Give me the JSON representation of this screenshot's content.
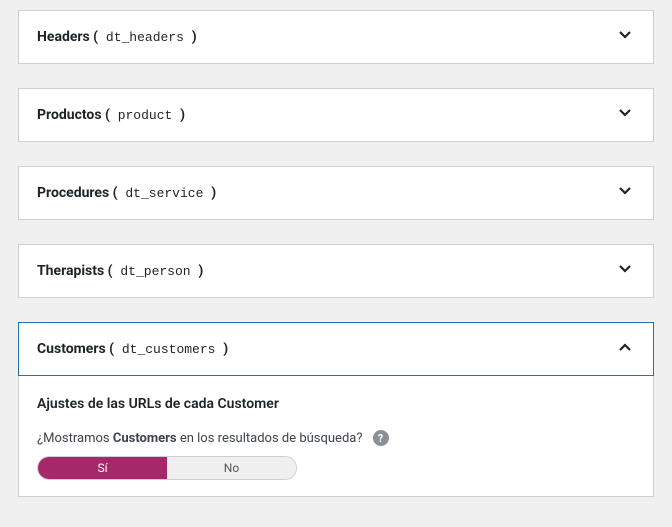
{
  "panels": [
    {
      "label": "Headers",
      "slug": "dt_headers",
      "expanded": false
    },
    {
      "label": "Productos",
      "slug": "product",
      "expanded": false
    },
    {
      "label": "Procedures",
      "slug": "dt_service",
      "expanded": false
    },
    {
      "label": "Therapists",
      "slug": "dt_person",
      "expanded": false
    },
    {
      "label": "Customers",
      "slug": "dt_customers",
      "expanded": true
    }
  ],
  "customers_body": {
    "section_title": "Ajustes de las URLs de cada Customer",
    "question_prefix": "¿Mostramos ",
    "question_bold": "Customers",
    "question_suffix": " en los resultados de búsqueda?",
    "help_glyph": "?",
    "toggle_yes": "Sí",
    "toggle_no": "No",
    "toggle_value": "yes"
  }
}
